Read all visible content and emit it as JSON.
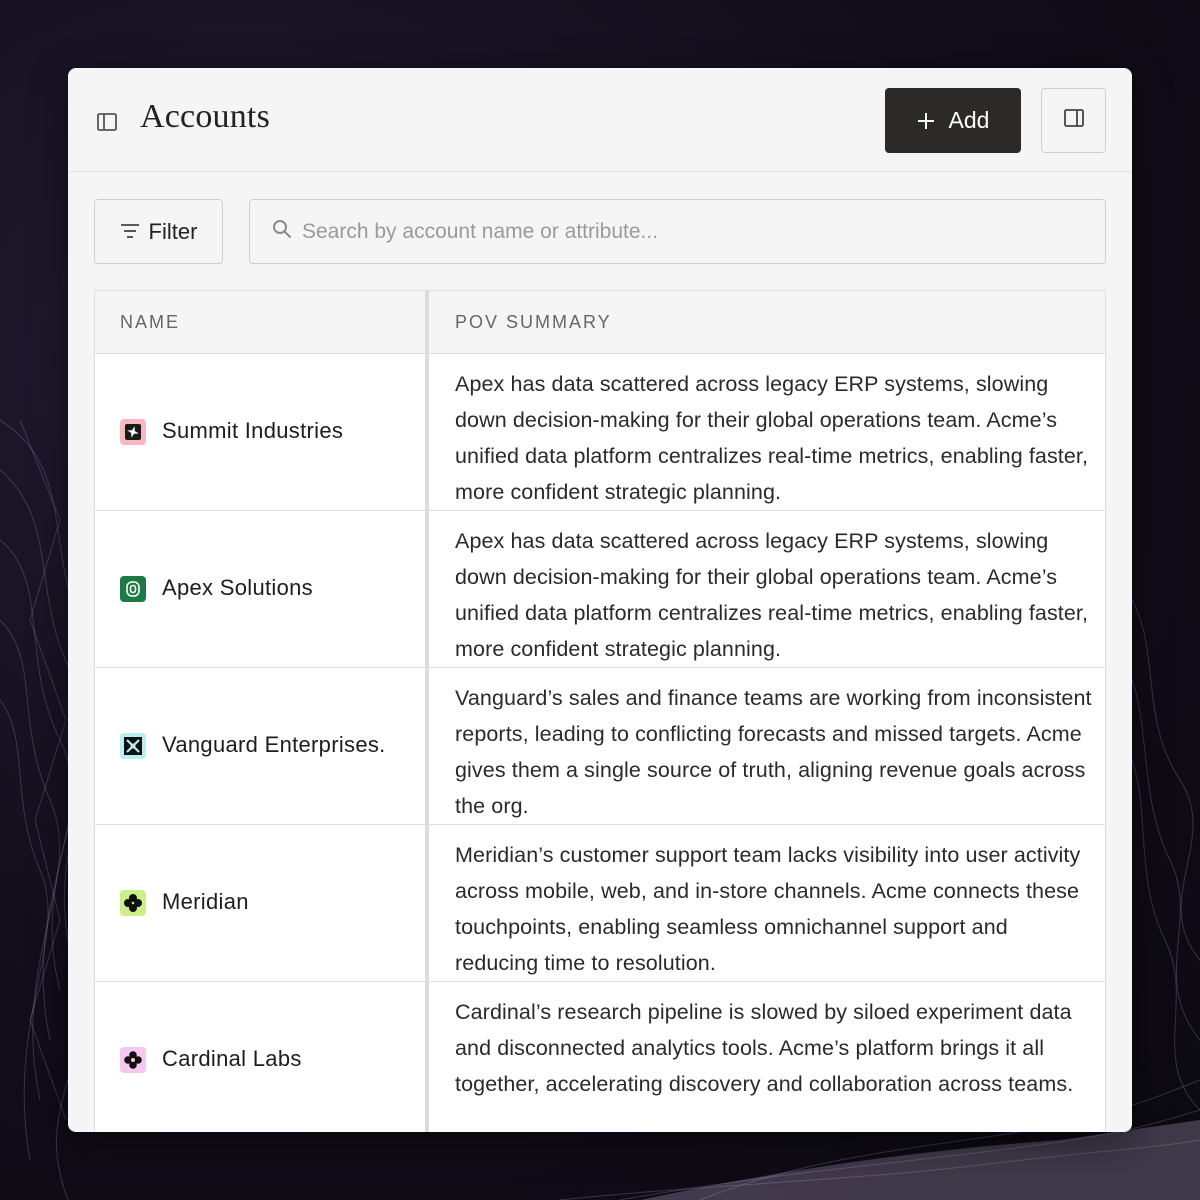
{
  "header": {
    "title": "Accounts",
    "add_label": "Add"
  },
  "toolbar": {
    "filter_label": "Filter",
    "search_placeholder": "Search by account name or attribute..."
  },
  "table": {
    "columns": [
      "NAME",
      "POV SUMMARY"
    ],
    "rows": [
      {
        "name": "Summit Industries",
        "logo_icon": "star-badge-icon",
        "logo_bg": "#f7b9bd",
        "summary": "Apex has data scattered across legacy ERP systems, slowing down decision-making for their global operations team. Acme’s unified data platform centralizes real-time metrics, enabling faster, more confident strategic planning."
      },
      {
        "name": "Apex Solutions",
        "logo_icon": "ring-badge-icon",
        "logo_bg": "#1e7a45",
        "summary": "Apex has data scattered across legacy ERP systems, slowing down decision-making for their global operations team. Acme’s unified data platform centralizes real-time metrics, enabling faster, more confident strategic planning."
      },
      {
        "name": "Vanguard Enterprises.",
        "logo_icon": "cross-badge-icon",
        "logo_bg": "#b9eef2",
        "summary": "Vanguard’s sales and finance teams are working from inconsistent reports, leading to conflicting forecasts and missed targets. Acme gives them a single source of truth, aligning revenue goals across the org."
      },
      {
        "name": "Meridian",
        "logo_icon": "clover-badge-icon",
        "logo_bg": "#cdef8a",
        "summary": "Meridian’s customer support team lacks visibility into user activity across mobile, web, and in-store channels. Acme connects these touchpoints, enabling seamless omnichannel support and reducing time to resolution."
      },
      {
        "name": "Cardinal Labs",
        "logo_icon": "flower-badge-icon",
        "logo_bg": "#f6c7f0",
        "summary": "Cardinal’s research pipeline is slowed by siloed experiment data and disconnected analytics tools. Acme’s platform brings it all together, accelerating discovery and collaboration across teams."
      }
    ]
  }
}
